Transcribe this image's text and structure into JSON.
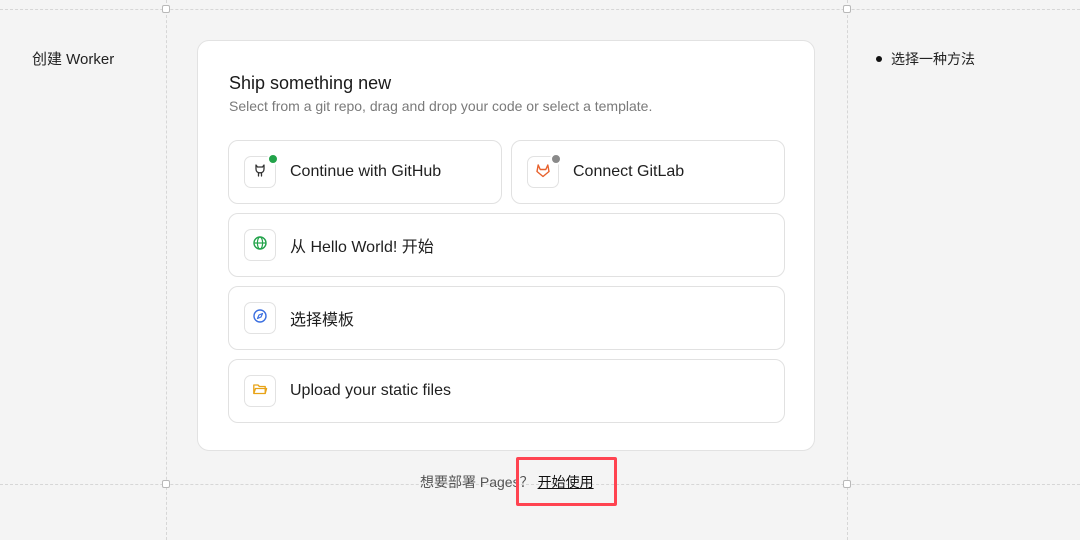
{
  "page": {
    "title": "创建 Worker"
  },
  "steps": {
    "items": [
      {
        "label": "选择一种方法"
      }
    ]
  },
  "card": {
    "title": "Ship something new",
    "subtitle": "Select from a git repo, drag and drop your code or select a template.",
    "options": {
      "github": {
        "label": "Continue with GitHub",
        "icon": "github-icon",
        "status_color": "#22a34a"
      },
      "gitlab": {
        "label": "Connect GitLab",
        "icon": "gitlab-icon",
        "status_color": "#8a8a8a"
      },
      "hello": {
        "label": "从 Hello World! 开始",
        "icon": "globe-icon",
        "icon_color": "#22a34a"
      },
      "template": {
        "label": "选择模板",
        "icon": "compass-icon",
        "icon_color": "#3b6fe0"
      },
      "upload": {
        "label": "Upload your static files",
        "icon": "folder-icon",
        "icon_color": "#e8a317"
      }
    }
  },
  "footer": {
    "prompt": "想要部署 Pages？",
    "link": "开始使用"
  },
  "annotation": {
    "highlight_color": "#ff4350"
  }
}
